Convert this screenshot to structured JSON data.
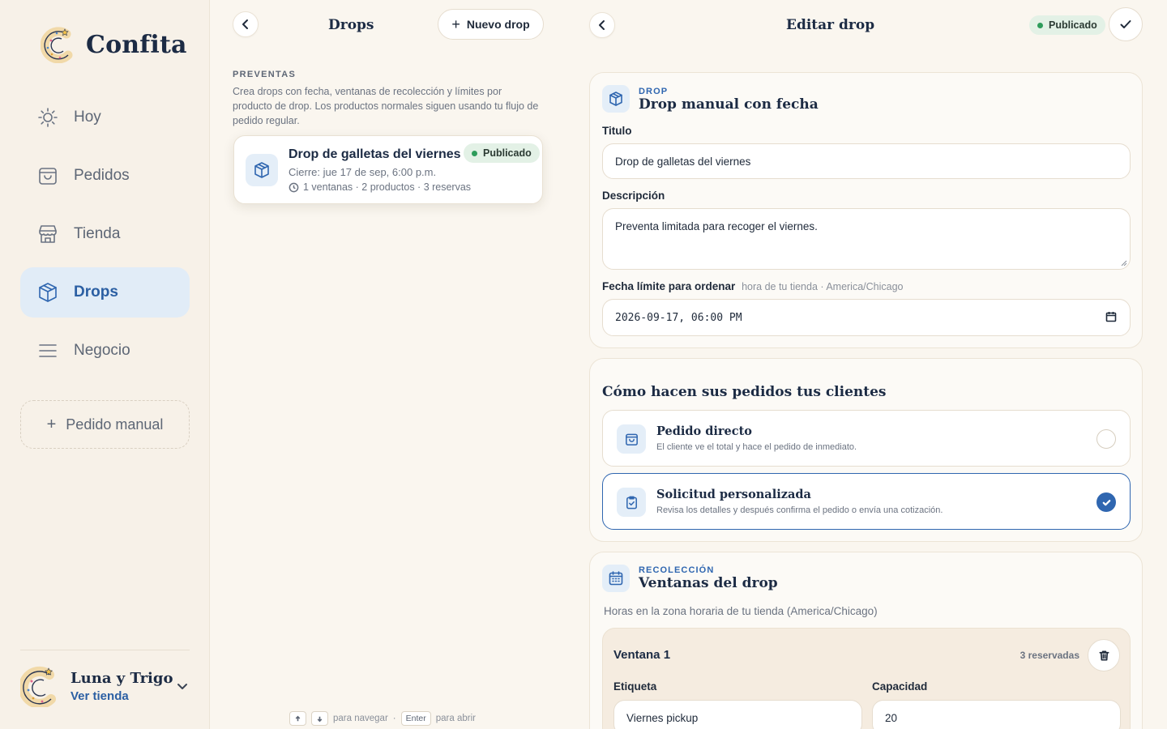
{
  "brand": {
    "name": "Confita"
  },
  "sidebar": {
    "items": [
      {
        "label": "Hoy",
        "icon": "sun-icon"
      },
      {
        "label": "Pedidos",
        "icon": "bag-icon"
      },
      {
        "label": "Tienda",
        "icon": "store-icon"
      },
      {
        "label": "Drops",
        "icon": "box-icon",
        "active": true
      },
      {
        "label": "Negocio",
        "icon": "menu-icon"
      }
    ],
    "manual_order": "Pedido manual",
    "profile": {
      "name": "Luna y Trigo",
      "link": "Ver tienda"
    }
  },
  "list": {
    "title": "Drops",
    "new_button": "Nuevo drop",
    "eyebrow": "PREVENTAS",
    "description": "Crea drops con fecha, ventanas de recolección y límites por producto de drop. Los productos normales siguen usando tu flujo de pedido regular.",
    "cards": [
      {
        "title": "Drop de galletas del viernes",
        "status": "Publicado",
        "close": "Cierre: jue 17 de sep, 6:00 p.m.",
        "meta": "1 ventanas · 2 productos · 3 reservas"
      }
    ],
    "hint": {
      "nav": "para navegar",
      "dot": "·",
      "enter_key": "Enter",
      "open": "para abrir"
    }
  },
  "editor": {
    "title": "Editar drop",
    "status": "Publicado",
    "drop_card": {
      "eyebrow": "DROP",
      "title": "Drop manual con fecha",
      "title_label": "Titulo",
      "title_value": "Drop de galletas del viernes",
      "description_label": "Descripción",
      "description_value": "Preventa limitada para recoger el viernes.",
      "deadline_label": "Fecha límite para ordenar",
      "deadline_hint": "hora de tu tienda · America/Chicago",
      "deadline_value": "2026-09-17, 06:00 PM"
    },
    "order_mode": {
      "title": "Cómo hacen sus pedidos tus clientes",
      "options": [
        {
          "title": "Pedido directo",
          "desc": "El cliente ve el total y hace el pedido de inmediato.",
          "selected": false
        },
        {
          "title": "Solicitud personalizada",
          "desc": "Revisa los detalles y después confirma el pedido o envía una cotización.",
          "selected": true
        }
      ]
    },
    "pickup": {
      "eyebrow": "RECOLECCIÓN",
      "title": "Ventanas del drop",
      "hint": "Horas en la zona horaria de tu tienda (America/Chicago)",
      "windows": [
        {
          "name": "Ventana 1",
          "reserved": "3 reservadas",
          "label_label": "Etiqueta",
          "label_value": "Viernes pickup",
          "capacity_label": "Capacidad",
          "capacity_value": "20"
        }
      ]
    }
  },
  "colors": {
    "accent": "#2f66b0",
    "accent_soft": "#e1ecf7",
    "success": "#2e9c5b",
    "background": "#faf6ef"
  }
}
